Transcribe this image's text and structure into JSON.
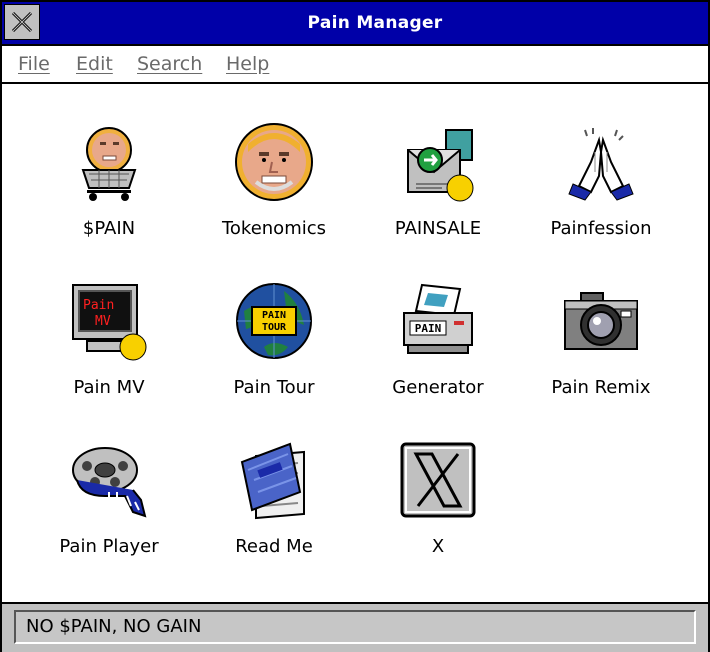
{
  "window": {
    "title": "Pain Manager"
  },
  "menu": {
    "file": "File",
    "edit": "Edit",
    "search": "Search",
    "help": "Help"
  },
  "icons": [
    {
      "label": "$PAIN",
      "icon": "shopping-cart-face-icon"
    },
    {
      "label": "Tokenomics",
      "icon": "face-coin-icon"
    },
    {
      "label": "PAINSALE",
      "icon": "envelope-sale-icon"
    },
    {
      "label": "Painfession",
      "icon": "praying-hands-icon"
    },
    {
      "label": "Pain MV",
      "icon": "monitor-icon"
    },
    {
      "label": "Pain Tour",
      "icon": "globe-icon"
    },
    {
      "label": "Generator",
      "icon": "printer-icon"
    },
    {
      "label": "Pain Remix",
      "icon": "camera-icon"
    },
    {
      "label": "Pain Player",
      "icon": "film-reel-icon"
    },
    {
      "label": "Read Me",
      "icon": "notepad-icon"
    },
    {
      "label": "X",
      "icon": "x-logo-icon"
    }
  ],
  "icon_text": {
    "monitor_line1": "Pain",
    "monitor_line2": "MV",
    "globe_line1": "PAIN",
    "globe_line2": "TOUR",
    "printer": "PAIN"
  },
  "status": {
    "text": "NO $PAIN, NO GAIN"
  },
  "colors": {
    "titlebar": "#0000a8",
    "status_bg": "#c0c0c0"
  }
}
